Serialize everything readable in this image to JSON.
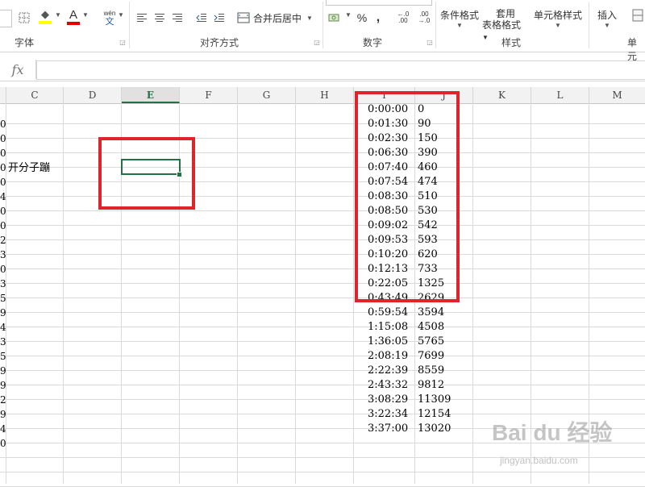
{
  "ribbon": {
    "groups": {
      "font": "字体",
      "alignment": "对齐方式",
      "number": "数字",
      "styles": "样式",
      "cells_partial": "单元"
    },
    "buttons": {
      "fill_color": "◆",
      "font_color": "A",
      "phonetic": "wén",
      "phonetic_sub": "文",
      "merge_center": "合并后居中",
      "percent": "%",
      "comma": ",",
      "increase_decimal": "←.0\n.00",
      "decrease_decimal": ".00\n→.0",
      "conditional_format": "条件格式",
      "format_table_line1": "套用",
      "format_table_line2": "表格格式",
      "cell_styles": "单元格样式",
      "insert": "插入"
    }
  },
  "formula_bar": {
    "fx": "fx",
    "value": ""
  },
  "columns": [
    "C",
    "D",
    "E",
    "F",
    "G",
    "H",
    "I",
    "J",
    "K",
    "L",
    "M"
  ],
  "selected_column": "E",
  "cells": {
    "c4_text": "开分子蹦"
  },
  "row_stubs": [
    "0",
    "0",
    "0",
    "0",
    "0",
    "4",
    "0",
    "0",
    "2",
    "3",
    "0",
    "3",
    "5",
    "9",
    "4",
    "3",
    "5",
    "9",
    "9",
    "2",
    "9",
    "4",
    "0"
  ],
  "data_rows": [
    {
      "time": "0:00:00",
      "value": "0"
    },
    {
      "time": "0:01:30",
      "value": "90"
    },
    {
      "time": "0:02:30",
      "value": "150"
    },
    {
      "time": "0:06:30",
      "value": "390"
    },
    {
      "time": "0:07:40",
      "value": "460"
    },
    {
      "time": "0:07:54",
      "value": "474"
    },
    {
      "time": "0:08:30",
      "value": "510"
    },
    {
      "time": "0:08:50",
      "value": "530"
    },
    {
      "time": "0:09:02",
      "value": "542"
    },
    {
      "time": "0:09:53",
      "value": "593"
    },
    {
      "time": "0:10:20",
      "value": "620"
    },
    {
      "time": "0:12:13",
      "value": "733"
    },
    {
      "time": "0:22:05",
      "value": "1325"
    },
    {
      "time": "0:43:49",
      "value": "2629"
    },
    {
      "time": "0:59:54",
      "value": "3594"
    },
    {
      "time": "1:15:08",
      "value": "4508"
    },
    {
      "time": "1:36:05",
      "value": "5765"
    },
    {
      "time": "2:08:19",
      "value": "7699"
    },
    {
      "time": "2:22:39",
      "value": "8559"
    },
    {
      "time": "2:43:32",
      "value": "9812"
    },
    {
      "time": "3:08:29",
      "value": "11309"
    },
    {
      "time": "3:22:34",
      "value": "12154"
    },
    {
      "time": "3:37:00",
      "value": "13020"
    }
  ],
  "watermark": {
    "main": "Bai du 经验",
    "sub": "jingyan.baidu.com"
  },
  "colors": {
    "annotation_red": "#e0242b",
    "excel_green": "#217346"
  }
}
